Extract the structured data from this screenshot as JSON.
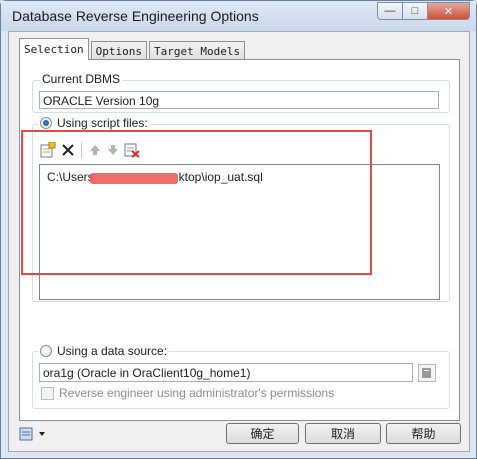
{
  "window": {
    "title": "Database Reverse Engineering Options",
    "controls": {
      "minimize": "—",
      "maximize": "□",
      "close": "✕"
    }
  },
  "tabs": [
    {
      "label": "Selection",
      "active": true
    },
    {
      "label": "Options",
      "active": false
    },
    {
      "label": "Target Models",
      "active": false
    }
  ],
  "current_dbms": {
    "legend": "Current DBMS",
    "value": "ORACLE Version 10g"
  },
  "script_files": {
    "label": "Using script files:",
    "selected": true,
    "toolbar": [
      "add-files-icon",
      "delete-icon",
      "move-up-icon",
      "move-down-icon",
      "clear-all-icon"
    ],
    "files": [
      {
        "prefix": "C:\\Users",
        "suffix": "ktop\\iop_uat.sql"
      }
    ]
  },
  "data_source": {
    "label": "Using a data source:",
    "selected": false,
    "value": "ora1g (Oracle in OraClient10g_home1)",
    "admin_checkbox": {
      "label": "Reverse engineer using administrator's permissions",
      "checked": false,
      "enabled": false
    }
  },
  "footer": {
    "ok": "确定",
    "cancel": "取消",
    "help": "帮助"
  },
  "colors": {
    "annotation": "#e24b4b",
    "redaction": "#f25a5a"
  }
}
